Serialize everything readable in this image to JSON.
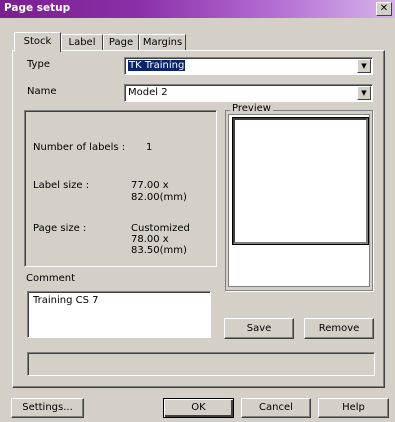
{
  "window": {
    "title": "Page setup",
    "close_symbol": "✕"
  },
  "tabs": [
    {
      "label": "Stock",
      "active": true
    },
    {
      "label": "Label",
      "active": false
    },
    {
      "label": "Page",
      "active": false
    },
    {
      "label": "Margins",
      "active": false
    }
  ],
  "type_field": {
    "label": "Type",
    "value": "TK Training"
  },
  "name_field": {
    "label": "Name",
    "value": "Model 2"
  },
  "info": {
    "number_of_labels_label": "Number of labels :",
    "number_of_labels_value": "1",
    "label_size_label": "Label size :",
    "label_size_value_1": "77.00 x",
    "label_size_value_2": "82.00(mm)",
    "page_size_label": "Page size :",
    "page_size_value_1": "Customized",
    "page_size_value_2": "78.00 x",
    "page_size_value_3": "83.50(mm)"
  },
  "preview": {
    "label": "Preview"
  },
  "comment": {
    "label": "Comment",
    "value": "Training CS 7"
  },
  "actions": {
    "save": "Save",
    "remove": "Remove"
  },
  "footer": {
    "settings": "Settings...",
    "ok": "OK",
    "cancel": "Cancel",
    "help": "Help"
  }
}
